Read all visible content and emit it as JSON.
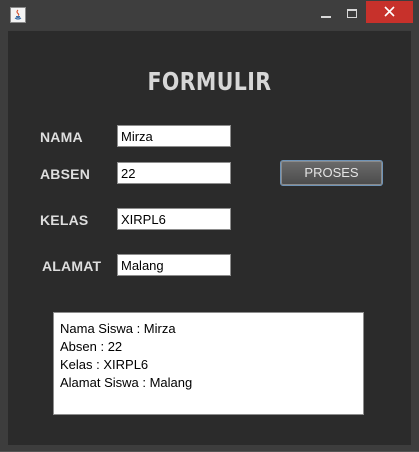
{
  "window": {
    "icon": "java-icon",
    "controls": {
      "minimize": "minimize-icon",
      "maximize": "maximize-icon",
      "close": "close-icon"
    }
  },
  "form": {
    "title": "FORMULIR",
    "labels": {
      "nama": "NAMA",
      "absen": "ABSEN",
      "kelas": "KELAS",
      "alamat": "ALAMAT"
    },
    "values": {
      "nama": "Mirza",
      "absen": "22",
      "kelas": "XIRPL6",
      "alamat": "Malang"
    },
    "button": "PROSES"
  },
  "output": {
    "lines": [
      "Nama Siswa : Mirza",
      "Absen : 22",
      "Kelas : XIRPL6",
      "Alamat Siswa : Malang"
    ]
  },
  "colors": {
    "background": "#2b2b2b",
    "close_button": "#c7312b",
    "button_border": "#6f93b6"
  }
}
